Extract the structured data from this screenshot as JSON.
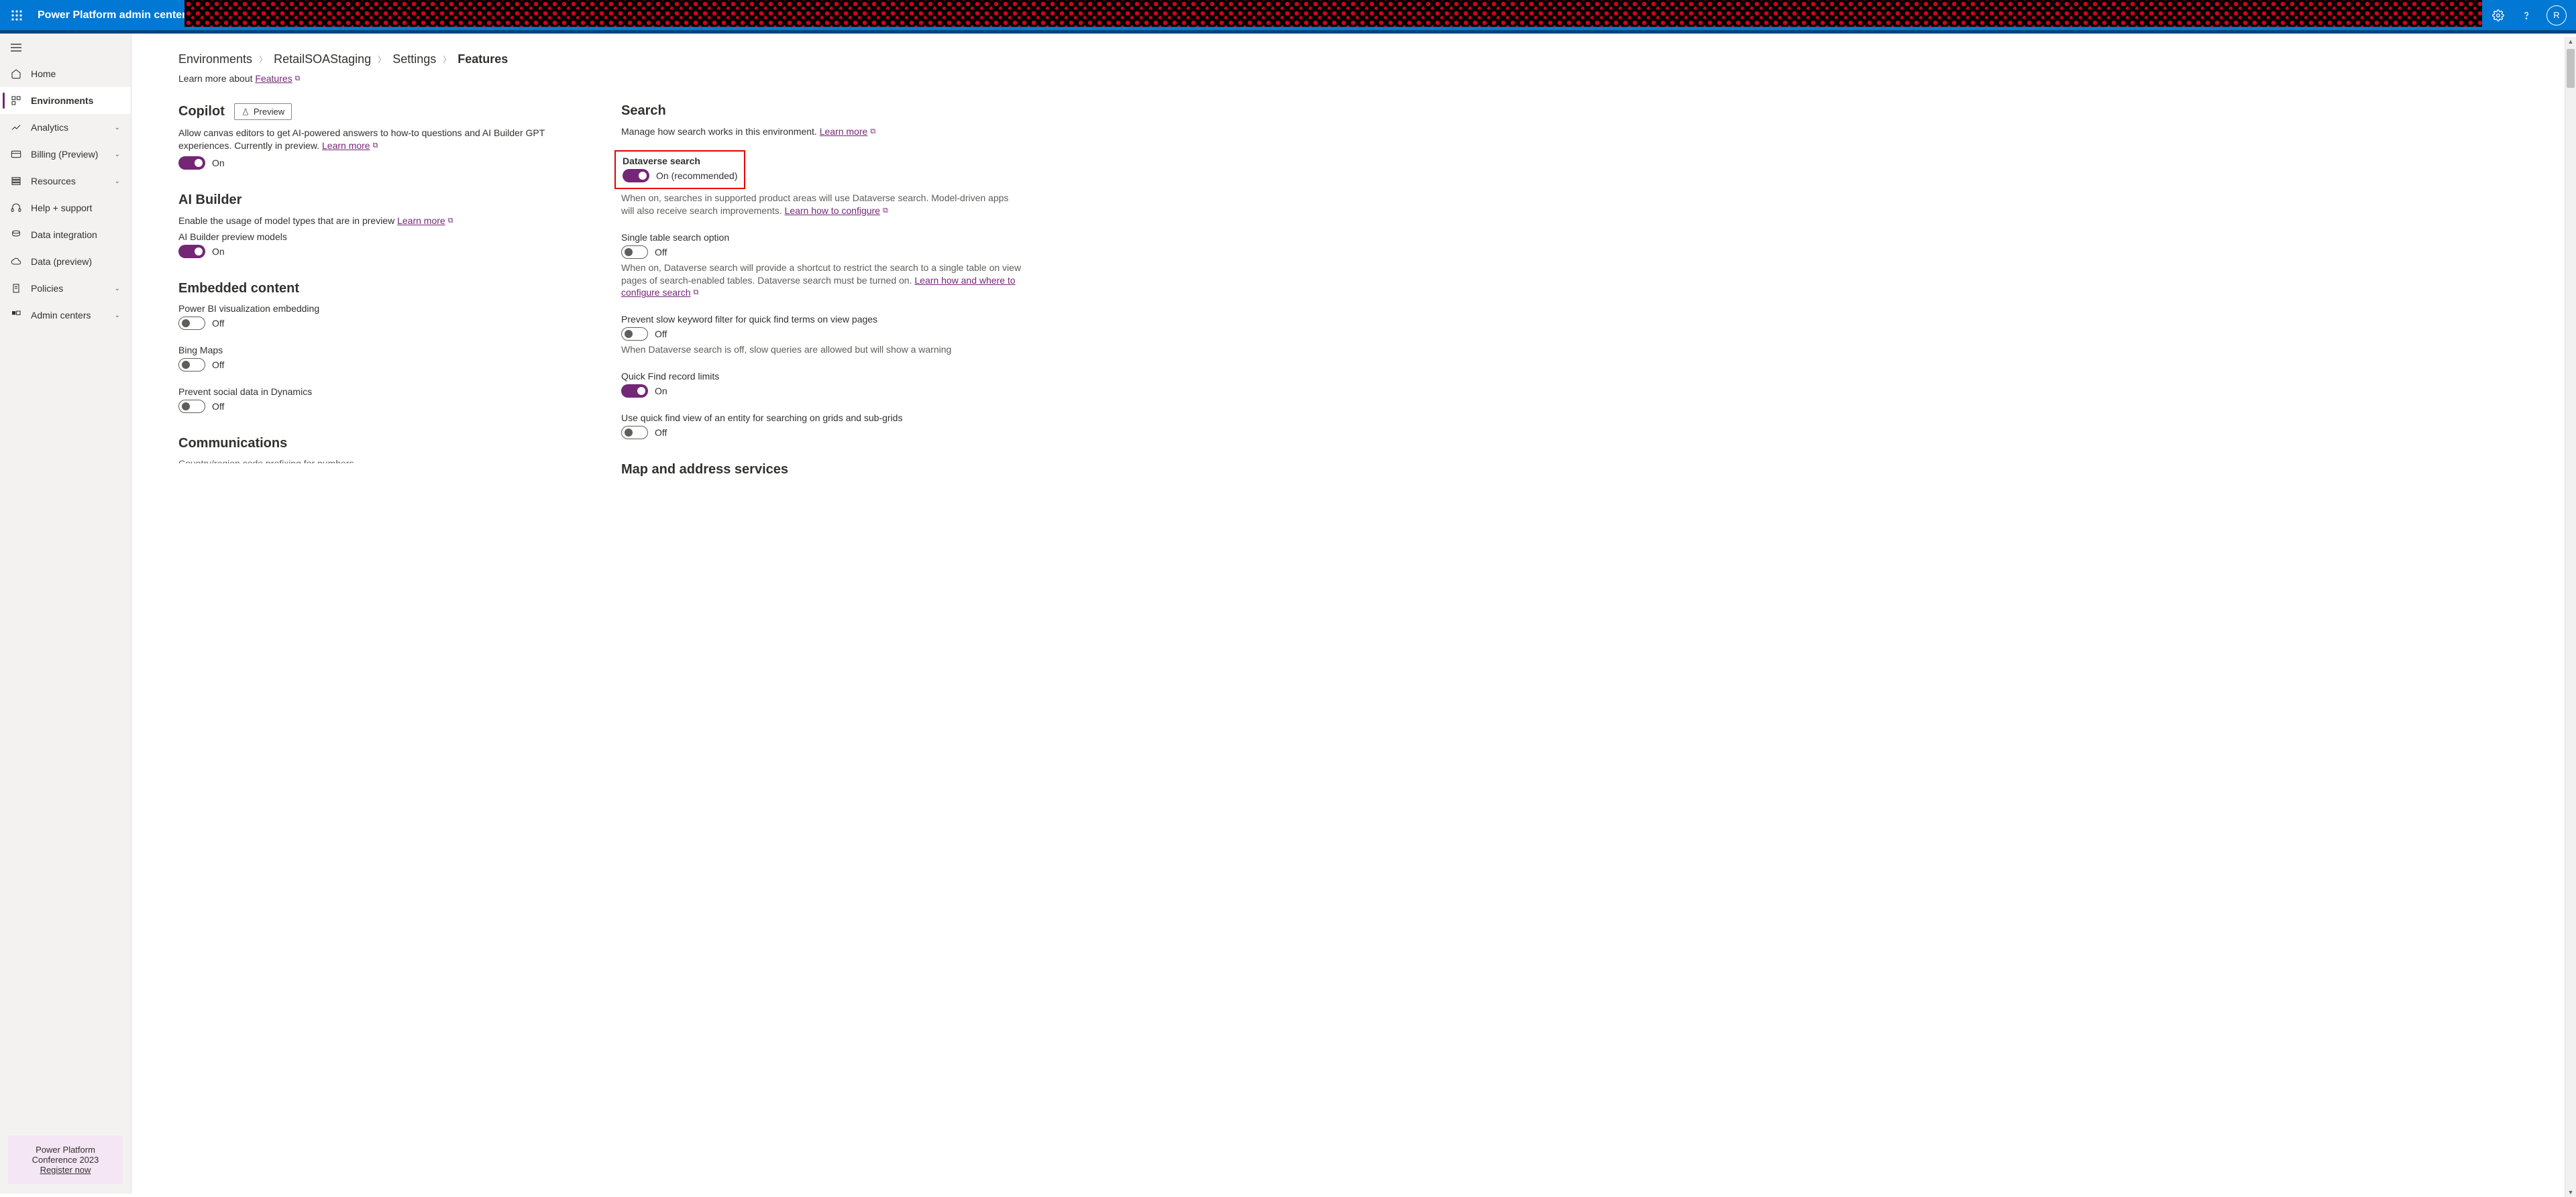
{
  "header": {
    "product": "Power Platform admin center",
    "avatar": "R"
  },
  "sidebar": {
    "items": [
      {
        "label": "Home"
      },
      {
        "label": "Environments"
      },
      {
        "label": "Analytics"
      },
      {
        "label": "Billing (Preview)"
      },
      {
        "label": "Resources"
      },
      {
        "label": "Help + support"
      },
      {
        "label": "Data integration"
      },
      {
        "label": "Data (preview)"
      },
      {
        "label": "Policies"
      },
      {
        "label": "Admin centers"
      }
    ],
    "promo_line1": "Power Platform",
    "promo_line2": "Conference 2023",
    "promo_link": "Register now"
  },
  "breadcrumb": {
    "items": [
      "Environments",
      "RetailSOAStaging",
      "Settings",
      "Features"
    ]
  },
  "learn_more": {
    "prefix": "Learn more about ",
    "link": "Features"
  },
  "sections": {
    "copilot": {
      "title": "Copilot",
      "preview": "Preview",
      "desc": "Allow canvas editors to get AI-powered answers to how-to questions and AI Builder GPT experiences. Currently in preview. ",
      "learn": "Learn more",
      "toggle_label": "On"
    },
    "aibuilder": {
      "title": "AI Builder",
      "desc": "Enable the usage of model types that are in preview ",
      "learn": "Learn more",
      "field": "AI Builder preview models",
      "toggle_label": "On"
    },
    "embedded": {
      "title": "Embedded content",
      "powerbi": {
        "label": "Power BI visualization embedding",
        "toggle_label": "Off"
      },
      "bing": {
        "label": "Bing Maps",
        "toggle_label": "Off"
      },
      "social": {
        "label": "Prevent social data in Dynamics",
        "toggle_label": "Off"
      }
    },
    "communications": {
      "title": "Communications",
      "cut": "Country/region code prefixing for numbers"
    },
    "search": {
      "title": "Search",
      "desc": "Manage how search works in this environment. ",
      "learn": "Learn more",
      "dataverse": {
        "label": "Dataverse search",
        "toggle_label": "On (recommended)",
        "help": "When on, searches in supported product areas will use Dataverse search. Model-driven apps will also receive search improvements. ",
        "help_link": "Learn how to configure"
      },
      "single": {
        "label": "Single table search option",
        "toggle_label": "Off",
        "help": "When on, Dataverse search will provide a shortcut to restrict the search to a single table on view pages of search-enabled tables. Dataverse search must be turned on. ",
        "help_link": "Learn how and where to configure search"
      },
      "slow": {
        "label": "Prevent slow keyword filter for quick find terms on view pages",
        "toggle_label": "Off",
        "help": "When Dataverse search is off, slow queries are allowed but will show a warning"
      },
      "quickfind": {
        "label": "Quick Find record limits",
        "toggle_label": "On"
      },
      "quickview": {
        "label": "Use quick find view of an entity for searching on grids and sub-grids",
        "toggle_label": "Off"
      }
    },
    "map": {
      "title": "Map and address services"
    }
  }
}
